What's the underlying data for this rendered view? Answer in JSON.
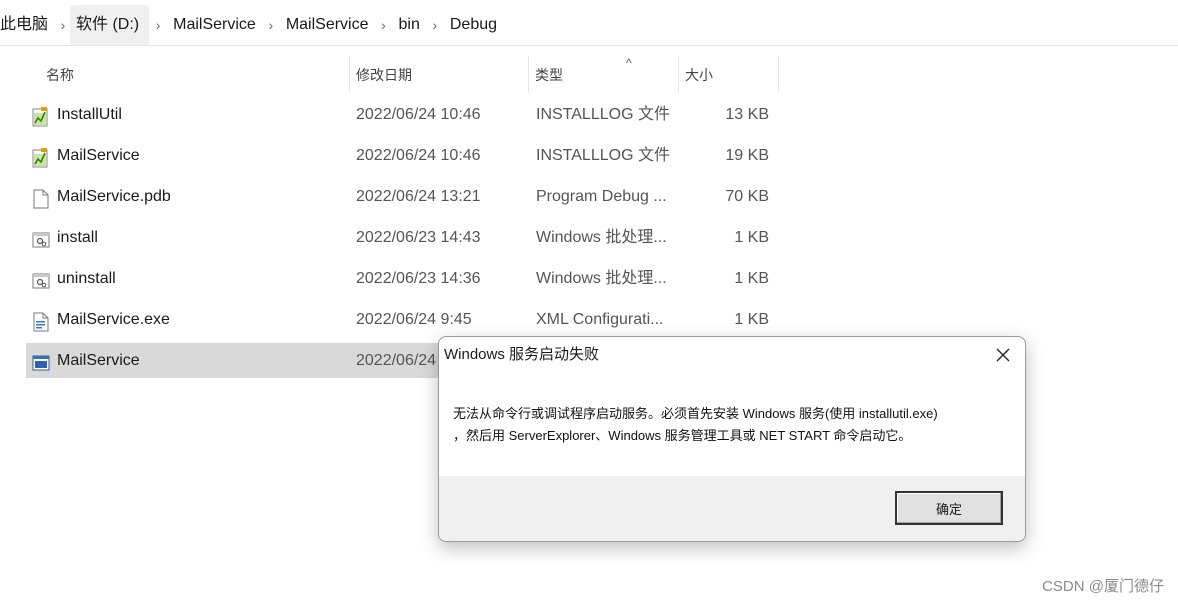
{
  "breadcrumb": {
    "items": [
      "此电脑",
      "软件 (D:)",
      "MailService",
      "MailService",
      "bin",
      "Debug"
    ]
  },
  "columns": {
    "name": "名称",
    "date": "修改日期",
    "type": "类型",
    "size": "大小"
  },
  "files": [
    {
      "icon": "installlog-file-icon",
      "name": "InstallUtil",
      "date": "2022/06/24 10:46",
      "type": "INSTALLLOG 文件",
      "size": "13 KB"
    },
    {
      "icon": "installlog-file-icon",
      "name": "MailService",
      "date": "2022/06/24 10:46",
      "type": "INSTALLLOG 文件",
      "size": "19 KB"
    },
    {
      "icon": "blank-file-icon",
      "name": "MailService.pdb",
      "date": "2022/06/24 13:21",
      "type": "Program Debug ...",
      "size": "70 KB"
    },
    {
      "icon": "batch-file-icon",
      "name": "install",
      "date": "2022/06/23 14:43",
      "type": "Windows 批处理...",
      "size": "1 KB"
    },
    {
      "icon": "batch-file-icon",
      "name": "uninstall",
      "date": "2022/06/23 14:36",
      "type": "Windows 批处理...",
      "size": "1 KB"
    },
    {
      "icon": "config-file-icon",
      "name": "MailService.exe",
      "date": "2022/06/24 9:45",
      "type": "XML Configurati...",
      "size": "1 KB"
    },
    {
      "icon": "exe-file-icon",
      "name": "MailService",
      "date": "2022/06/24",
      "type": "",
      "size": ""
    }
  ],
  "dialog": {
    "title": "Windows 服务启动失败",
    "message_line1": "无法从命令行或调试程序启动服务。必须首先安装 Windows 服务(使用 installutil.exe)",
    "message_line2": "，然后用 ServerExplorer、Windows 服务管理工具或 NET START 命令启动它。",
    "ok_label": "确定"
  },
  "watermark": "CSDN @厦门德仔",
  "sort_indicator": "^"
}
